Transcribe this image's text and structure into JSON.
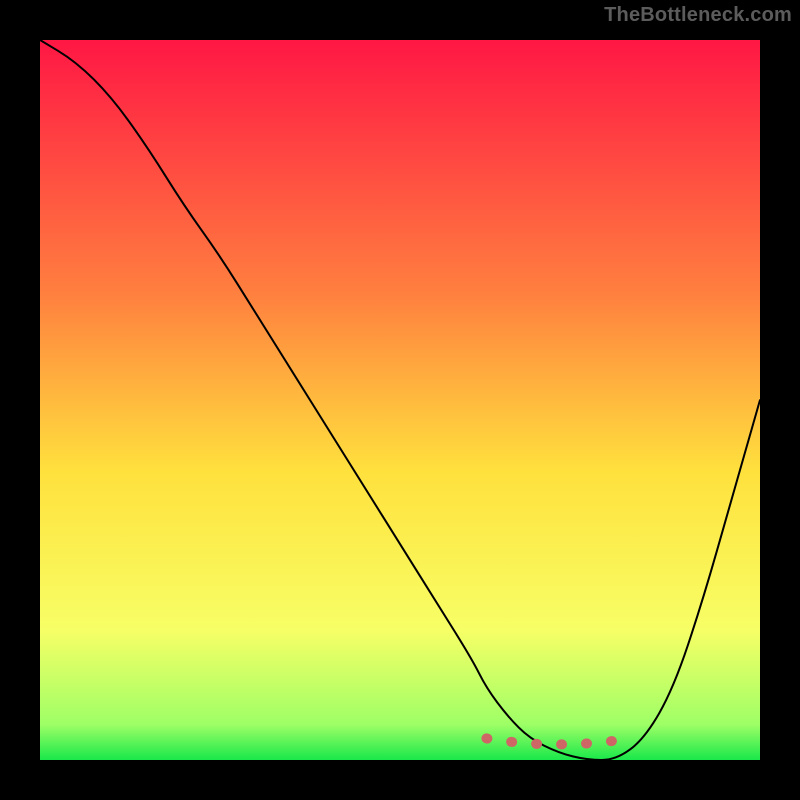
{
  "watermark": "TheBottleneck.com",
  "chart_data": {
    "type": "line",
    "title": "",
    "xlabel": "",
    "ylabel": "",
    "xlim": [
      0,
      100
    ],
    "ylim": [
      0,
      100
    ],
    "grid": false,
    "legend": false,
    "gradient_stops": [
      {
        "offset": 0,
        "color": "#ff1744"
      },
      {
        "offset": 35,
        "color": "#ff7f3f"
      },
      {
        "offset": 60,
        "color": "#ffe13d"
      },
      {
        "offset": 82,
        "color": "#f7ff66"
      },
      {
        "offset": 95,
        "color": "#9fff66"
      },
      {
        "offset": 100,
        "color": "#19e84a"
      }
    ],
    "series": [
      {
        "name": "curve",
        "x": [
          0,
          5,
          10,
          15,
          20,
          25,
          30,
          35,
          40,
          45,
          50,
          55,
          60,
          62,
          65,
          68,
          72,
          76,
          80,
          84,
          88,
          92,
          96,
          100
        ],
        "y": [
          100,
          97,
          92,
          85,
          77,
          70,
          62,
          54,
          46,
          38,
          30,
          22,
          14,
          10,
          6,
          3,
          1,
          0,
          0,
          3,
          10,
          22,
          36,
          50
        ]
      }
    ],
    "trough_marker": {
      "color": "#ce6666",
      "x_range": [
        62,
        82
      ],
      "y": 3
    }
  }
}
